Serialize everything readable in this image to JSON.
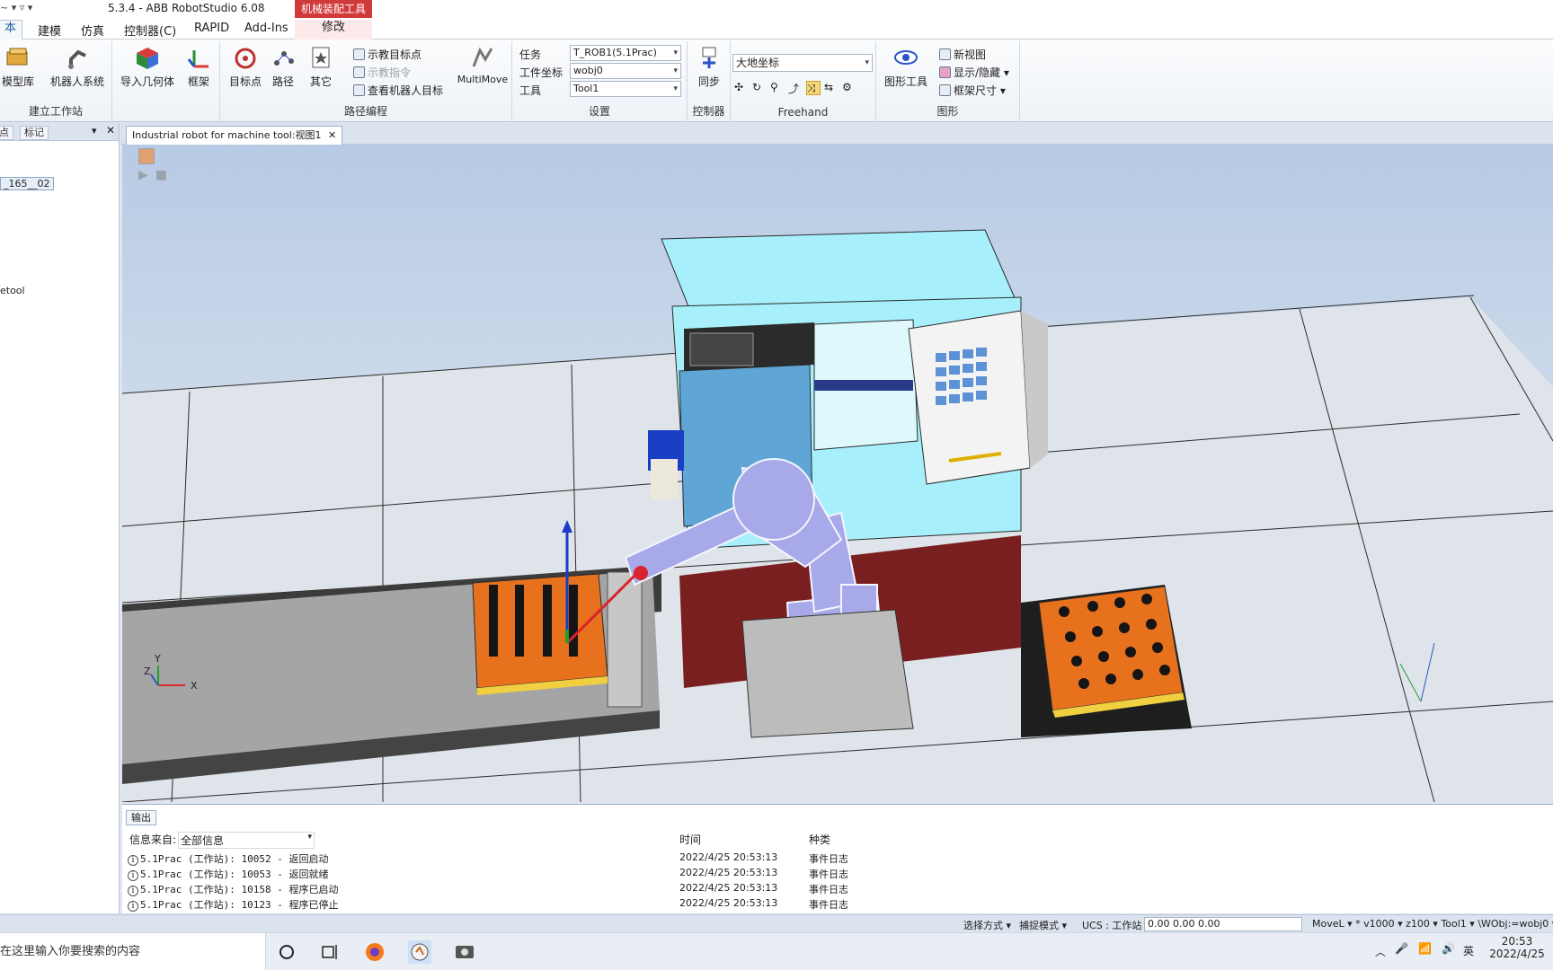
{
  "titlebar": {
    "title": "5.3.4 - ABB RobotStudio 6.08",
    "context_tab_group": "机械装配工具"
  },
  "tabs": [
    {
      "label": "本",
      "active": true
    },
    {
      "label": "建模"
    },
    {
      "label": "仿真"
    },
    {
      "label": "控制器(C)"
    },
    {
      "label": "RAPID"
    },
    {
      "label": "Add-Ins"
    },
    {
      "label": "修改"
    }
  ],
  "ribbon": {
    "build_station": {
      "label": "建立工作站",
      "buttons": [
        "模型库",
        "机器人系统",
        "导入几何体",
        "框架"
      ]
    },
    "path_programming": {
      "label": "路径编程",
      "buttons": [
        "目标点",
        "路径",
        "其它"
      ],
      "small": [
        "示教目标点",
        "示教指令",
        "查看机器人目标"
      ],
      "multimove": "MultiMove"
    },
    "settings": {
      "label": "设置",
      "task_label": "任务",
      "task_value": "T_ROB1(5.1Prac)",
      "wobj_label": "工件坐标",
      "wobj_value": "wobj0",
      "tool_label": "工具",
      "tool_value": "Tool1"
    },
    "controller": {
      "label": "控制器",
      "sync": "同步"
    },
    "freehand": {
      "label": "Freehand",
      "frame_value": "大地坐标"
    },
    "graphics": {
      "label": "图形",
      "tools": "图形工具",
      "new_view": "新视图",
      "show_hide": "显示/隐藏",
      "frame_size": "框架尺寸"
    }
  },
  "left_panel": {
    "tabs": [
      "点",
      "标记"
    ],
    "items": [
      "_165__02",
      "etool"
    ]
  },
  "document": {
    "tab_title": "Industrial robot for machine tool:视图1"
  },
  "viewport": {
    "axis_labels": {
      "x": "X",
      "y": "Y",
      "z": "Z"
    }
  },
  "output": {
    "tab": "输出",
    "filter_label": "信息来自:",
    "filter_value": "全部信息",
    "columns": [
      "时间",
      "种类"
    ],
    "rows": [
      {
        "message": "5.1Prac (工作站): 10052 - 返回启动",
        "time": "2022/4/25 20:53:13",
        "type": "事件日志"
      },
      {
        "message": "5.1Prac (工作站): 10053 - 返回就绪",
        "time": "2022/4/25 20:53:13",
        "type": "事件日志"
      },
      {
        "message": "5.1Prac (工作站): 10158 - 程序已启动",
        "time": "2022/4/25 20:53:13",
        "type": "事件日志"
      },
      {
        "message": "5.1Prac (工作站): 10123 - 程序已停止",
        "time": "2022/4/25 20:53:13",
        "type": "事件日志"
      }
    ]
  },
  "statusbar": {
    "select_mode": "选择方式 ▾",
    "snap_mode": "捕捉模式 ▾",
    "ucs": "UCS : 工作站",
    "coords": "0.00  0.00  0.00",
    "instruction": "MoveL ▾ * v1000 ▾ z100 ▾ Tool1 ▾ \\WObj:=wobj0 ▾"
  },
  "taskbar": {
    "search_placeholder": "在这里输入你要搜索的内容",
    "ime": "英",
    "time": "20:53",
    "date": "2022/4/25"
  },
  "colors": {
    "machine_body": "#a7f0fb",
    "fixture_orange": "#e8711e",
    "robot": "#a8a9e8",
    "floor": "#dfe4ea"
  }
}
